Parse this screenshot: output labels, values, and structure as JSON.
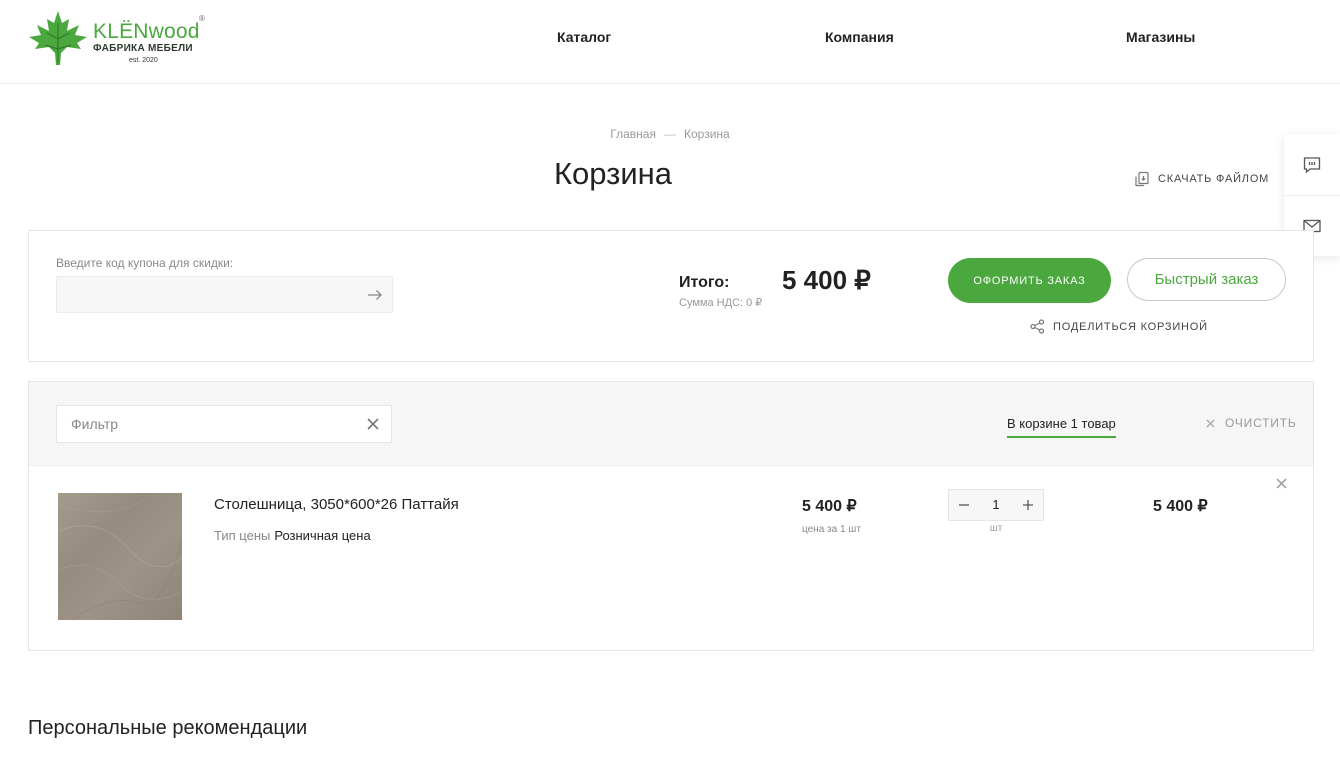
{
  "header": {
    "logo": {
      "brand": "KLËNwood",
      "subtitle": "ФАБРИКА МЕБЕЛИ",
      "est": "est. 2020",
      "reg": "®"
    },
    "nav": [
      "Каталог",
      "Компания",
      "Магазины"
    ]
  },
  "breadcrumb": {
    "home": "Главная",
    "separator": "—",
    "current": "Корзина"
  },
  "page": {
    "title": "Корзина",
    "download_label": "СКАЧАТЬ ФАЙЛОМ"
  },
  "side_panel": {
    "icons": [
      "chat-icon",
      "mail-icon"
    ]
  },
  "summary": {
    "coupon_label": "Введите код купона для скидки:",
    "coupon_value": "",
    "total_label": "Итого:",
    "total_value": "5 400 ₽",
    "vat_label": "Сумма НДС: 0 ₽",
    "order_button": "ОФОРМИТЬ ЗАКАЗ",
    "quick_button": "Быстрый заказ",
    "share_label": "ПОДЕЛИТЬСЯ КОРЗИНОЙ"
  },
  "cart": {
    "filter_placeholder": "Фильтр",
    "count_label": "В корзине 1 товар",
    "clear_label": "ОЧИСТИТЬ",
    "items": [
      {
        "name": "Столешница, 3050*600*26 Паттайя",
        "price_type_label": "Тип цены",
        "price_type_value": "Розничная цена",
        "unit_price": "5 400 ₽",
        "unit_price_note": "цена за 1 шт",
        "quantity": "1",
        "quantity_unit": "шт",
        "total": "5 400 ₽"
      }
    ]
  },
  "recommendations": {
    "title": "Персональные рекомендации"
  },
  "colors": {
    "accent": "#4aa83e",
    "border": "#e5e5e5",
    "muted": "#888888"
  }
}
